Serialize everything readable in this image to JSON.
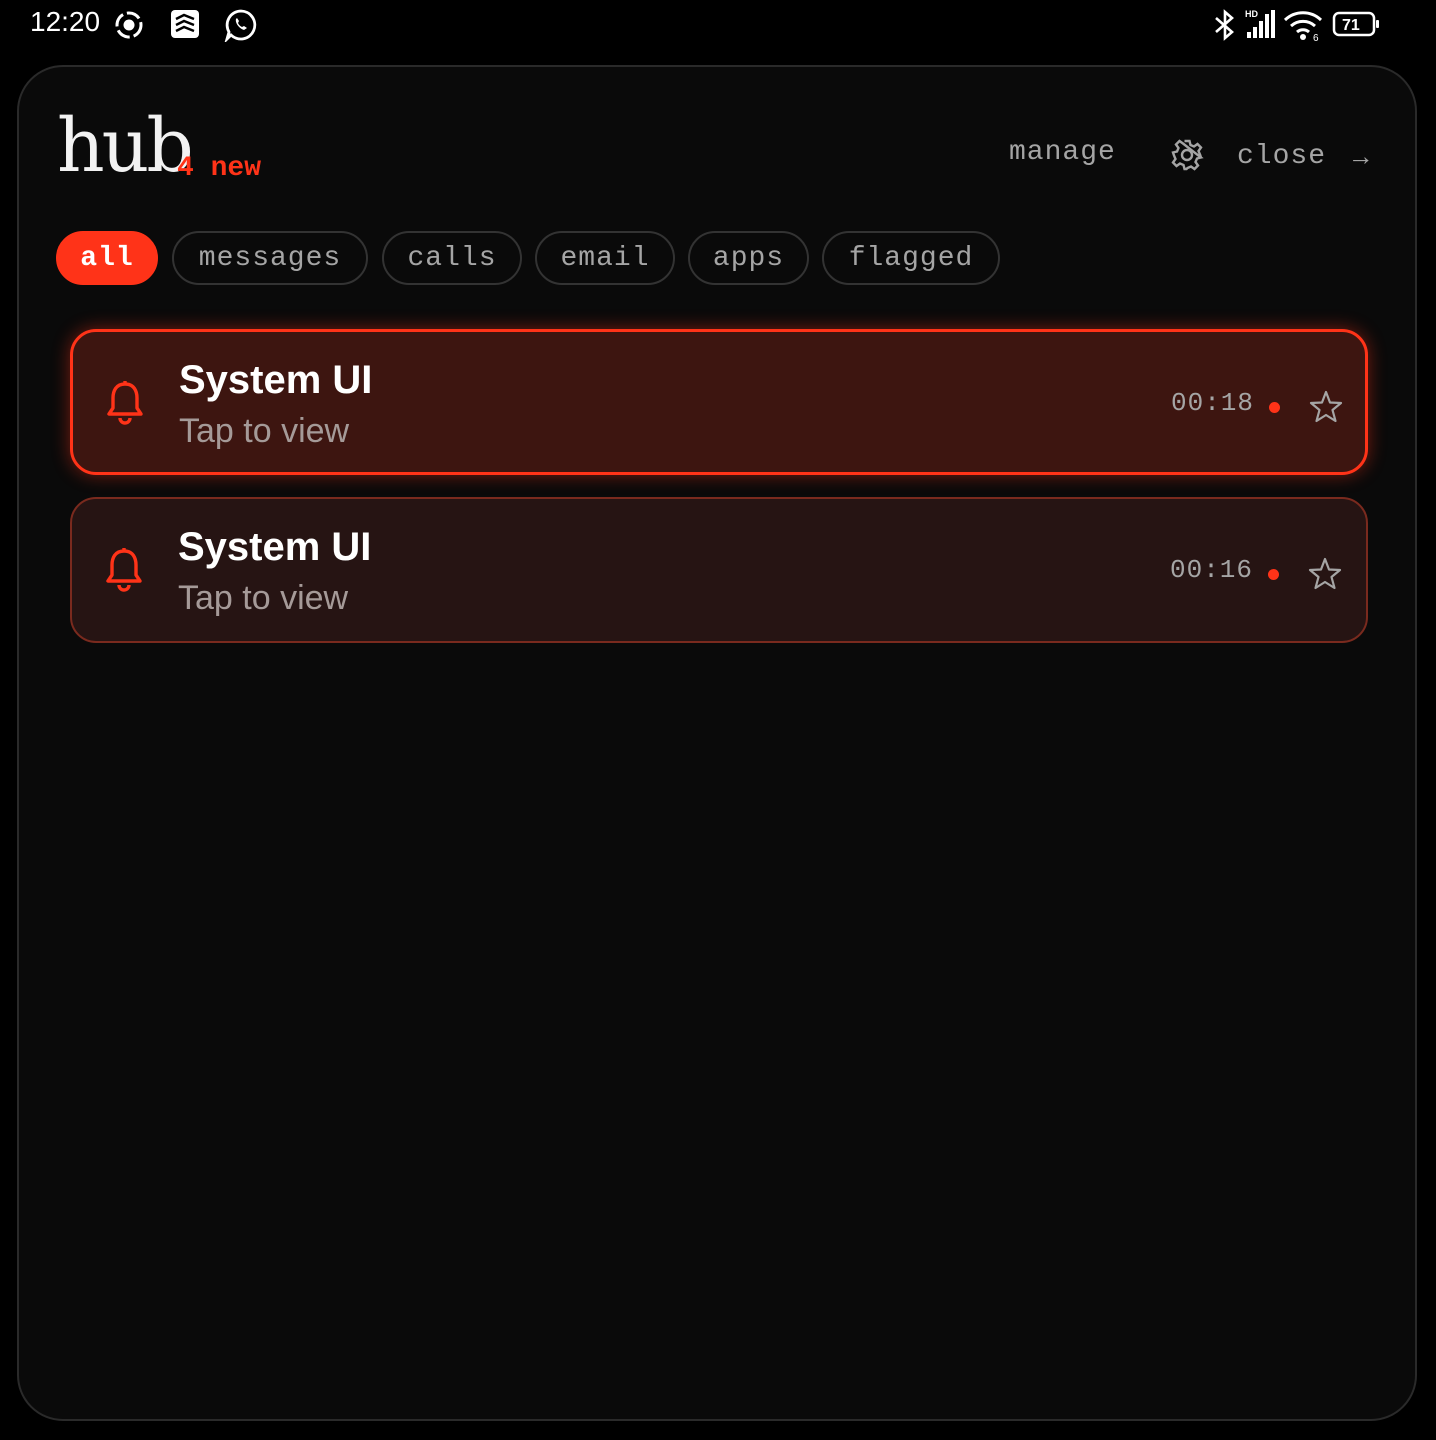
{
  "status_bar": {
    "time": "12:20",
    "battery": "71",
    "icons": [
      "screen-record-icon",
      "task-app-icon",
      "whatsapp-icon",
      "bluetooth-icon",
      "hd-signal-icon",
      "wifi-icon",
      "battery-icon"
    ]
  },
  "header": {
    "title": "hub",
    "new_count": "4 new",
    "manage_label": "manage",
    "close_label": "close",
    "close_arrow": "→"
  },
  "filters": [
    {
      "label": "all",
      "active": true
    },
    {
      "label": "messages",
      "active": false
    },
    {
      "label": "calls",
      "active": false
    },
    {
      "label": "email",
      "active": false
    },
    {
      "label": "apps",
      "active": false
    },
    {
      "label": "flagged",
      "active": false
    }
  ],
  "notifications": [
    {
      "title": "System UI",
      "subtitle": "Tap to view",
      "time": "00:18",
      "unread": true
    },
    {
      "title": "System UI",
      "subtitle": "Tap to view",
      "time": "00:16",
      "unread": true
    }
  ],
  "colors": {
    "accent": "#ff3318",
    "panel_bg": "#0a0a0a",
    "card_active_bg": "#3d1510",
    "card_bg": "#261413",
    "muted_text": "#a5a5a5"
  }
}
